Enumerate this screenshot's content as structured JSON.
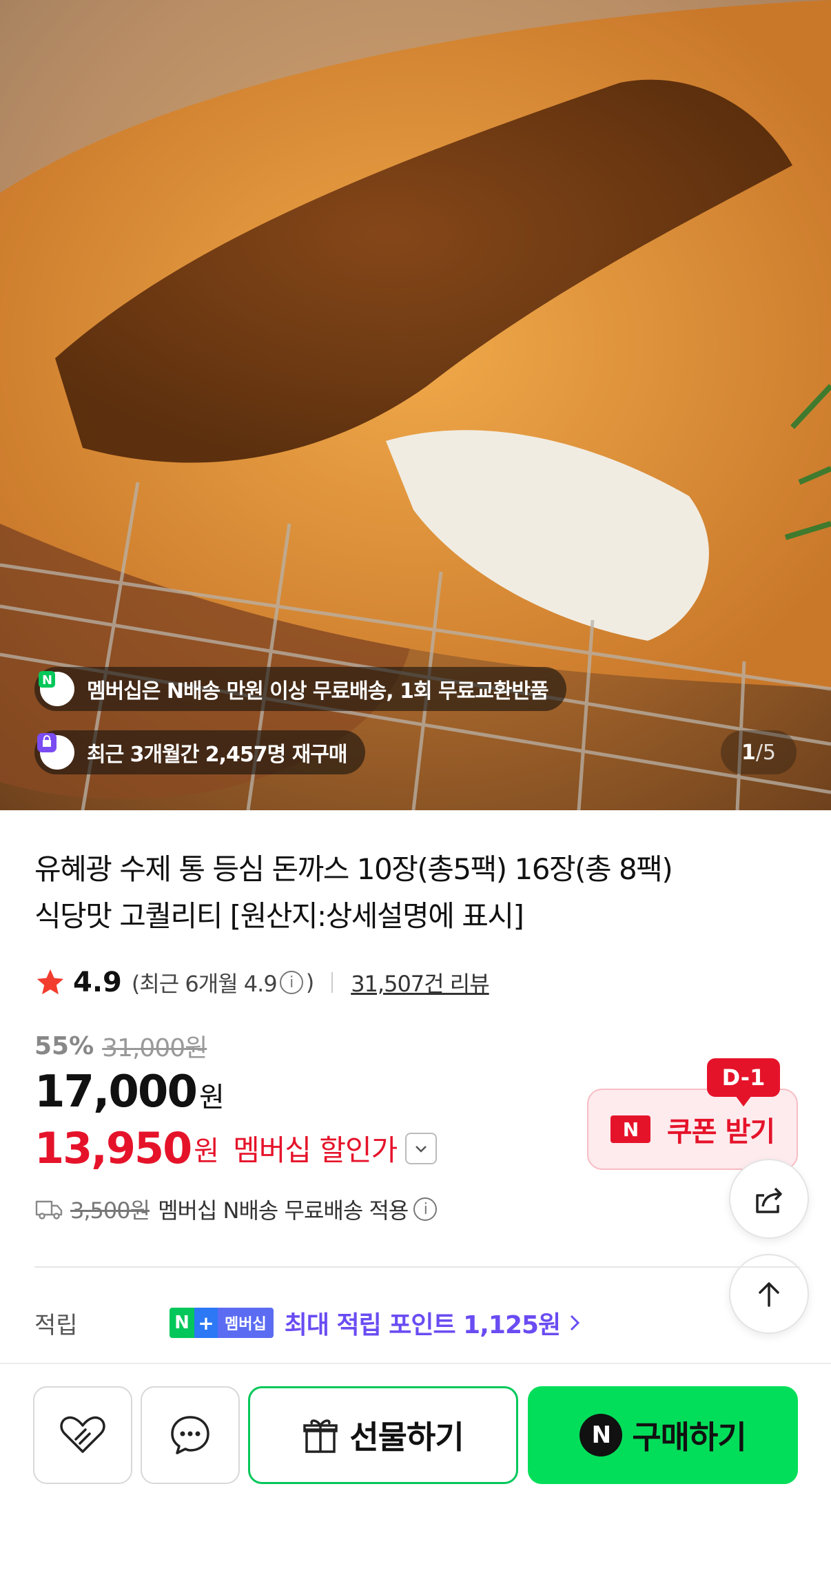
{
  "hero": {
    "membership_notice": "멤버십은 N배송 만원 이상 무료배송, 1회 무료교환반품",
    "repurchase_notice": "최근 3개월간 2,457명 재구매",
    "image_index": "1",
    "image_total": "/5"
  },
  "product": {
    "title_line1": "유혜광 수제 통 등심 돈까스 10장(총5팩) 16장(총 8팩)",
    "title_line2": "식당맛 고퀄리티 [원산지:상세설명에 표시]"
  },
  "rating": {
    "score": "4.9",
    "recent_prefix": "(최근 6개월 4.9",
    "recent_suffix": ")",
    "review_count": "31,507건 리뷰"
  },
  "price": {
    "discount_rate": "55%",
    "original_price": "31,000원",
    "sale_price": "17,000",
    "currency": "원",
    "member_price": "13,950",
    "member_label": "멤버십 할인가"
  },
  "coupon": {
    "label": "쿠폰 받기",
    "deadline_badge": "D-1",
    "n_mark": "N"
  },
  "shipping": {
    "original_fee": "3,500원",
    "text": "멤버십 N배송 무료배송 적용"
  },
  "points": {
    "label": "적립",
    "badge_n": "N",
    "badge_plus": "+",
    "badge_member": "멤버십",
    "text": "최대 적립 포인트 1,125원"
  },
  "actions": {
    "gift_label": "선물하기",
    "buy_label": "구매하기",
    "buy_logo": "N"
  },
  "colors": {
    "accent_red": "#e5132a",
    "naver_green": "#03de5a",
    "points_purple": "#6a4cf2"
  },
  "icons": {
    "star": "star-icon",
    "share": "share-icon",
    "scroll_top": "arrow-up-icon",
    "wishlist": "heart-icon",
    "talk": "chat-icon",
    "gift": "gift-icon",
    "truck": "truck-icon"
  }
}
